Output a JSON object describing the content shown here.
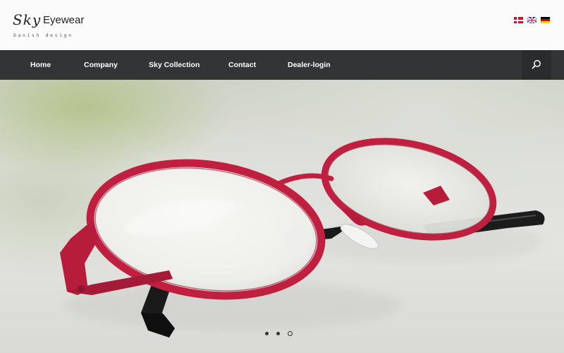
{
  "brand": {
    "script_name": "Sky",
    "name": "Eyewear",
    "tagline": "Danish design"
  },
  "languages": [
    {
      "code": "da",
      "icon": "denmark-flag-icon"
    },
    {
      "code": "en",
      "icon": "uk-flag-icon"
    },
    {
      "code": "de",
      "icon": "germany-flag-icon"
    }
  ],
  "nav": {
    "items": [
      {
        "label": "Home"
      },
      {
        "label": "Company"
      },
      {
        "label": "Sky Collection"
      },
      {
        "label": "Contact"
      },
      {
        "label": "Dealer-login"
      }
    ],
    "search_icon": "search-icon"
  },
  "slider": {
    "slide_count": 3,
    "active_index": 2
  },
  "colors": {
    "nav_background": "#333436",
    "frame_red": "#c01f3f",
    "header_background": "#fbfbfb"
  }
}
